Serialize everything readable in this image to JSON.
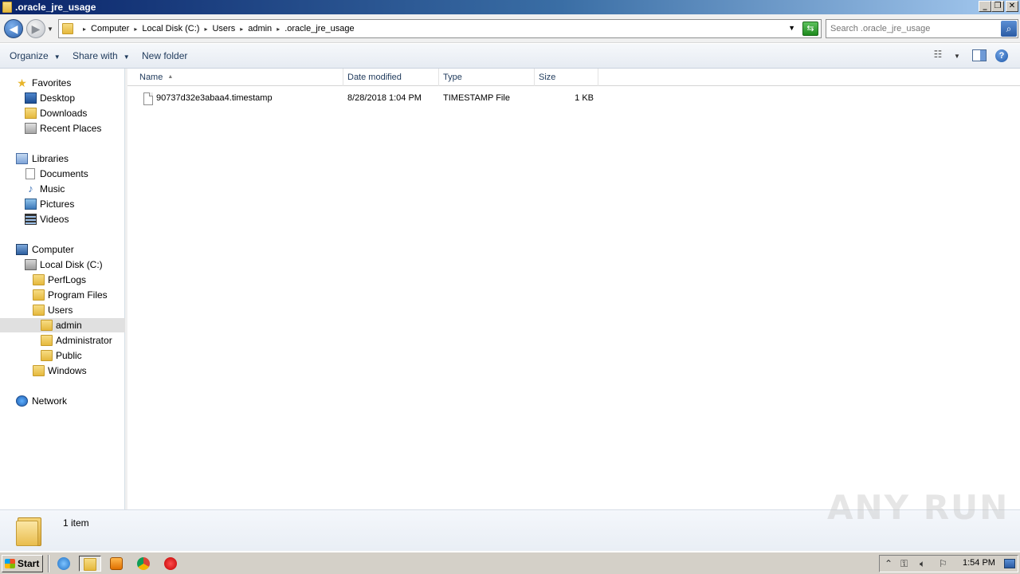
{
  "window": {
    "title": ".oracle_jre_usage",
    "buttons": {
      "minimize": "_",
      "restore": "❐",
      "close": "✕"
    }
  },
  "address": {
    "breadcrumbs": [
      "Computer",
      "Local Disk (C:)",
      "Users",
      "admin",
      ".oracle_jre_usage"
    ]
  },
  "search": {
    "placeholder": "Search .oracle_jre_usage"
  },
  "toolbar": {
    "organize": "Organize",
    "share_with": "Share with",
    "new_folder": "New folder"
  },
  "nav": {
    "favorites": "Favorites",
    "desktop": "Desktop",
    "downloads": "Downloads",
    "recent_places": "Recent Places",
    "libraries": "Libraries",
    "documents": "Documents",
    "music": "Music",
    "pictures": "Pictures",
    "videos": "Videos",
    "computer": "Computer",
    "local_disk": "Local Disk (C:)",
    "perflogs": "PerfLogs",
    "program_files": "Program Files",
    "users": "Users",
    "admin": "admin",
    "administrator": "Administrator",
    "public": "Public",
    "windows": "Windows",
    "network": "Network"
  },
  "columns": {
    "name": "Name",
    "date_modified": "Date modified",
    "type": "Type",
    "size": "Size"
  },
  "files": [
    {
      "name": "90737d32e3abaa4.timestamp",
      "date_modified": "8/28/2018 1:04 PM",
      "type": "TIMESTAMP File",
      "size": "1 KB"
    }
  ],
  "details": {
    "item_count": "1 item"
  },
  "watermark": "ANY RUN",
  "taskbar": {
    "start": "Start",
    "clock": "1:54 PM"
  },
  "icons": {
    "back": "back-arrow-icon",
    "forward": "forward-arrow-icon",
    "search": "search-icon",
    "refresh": "refresh-icon",
    "help": "help-icon"
  }
}
